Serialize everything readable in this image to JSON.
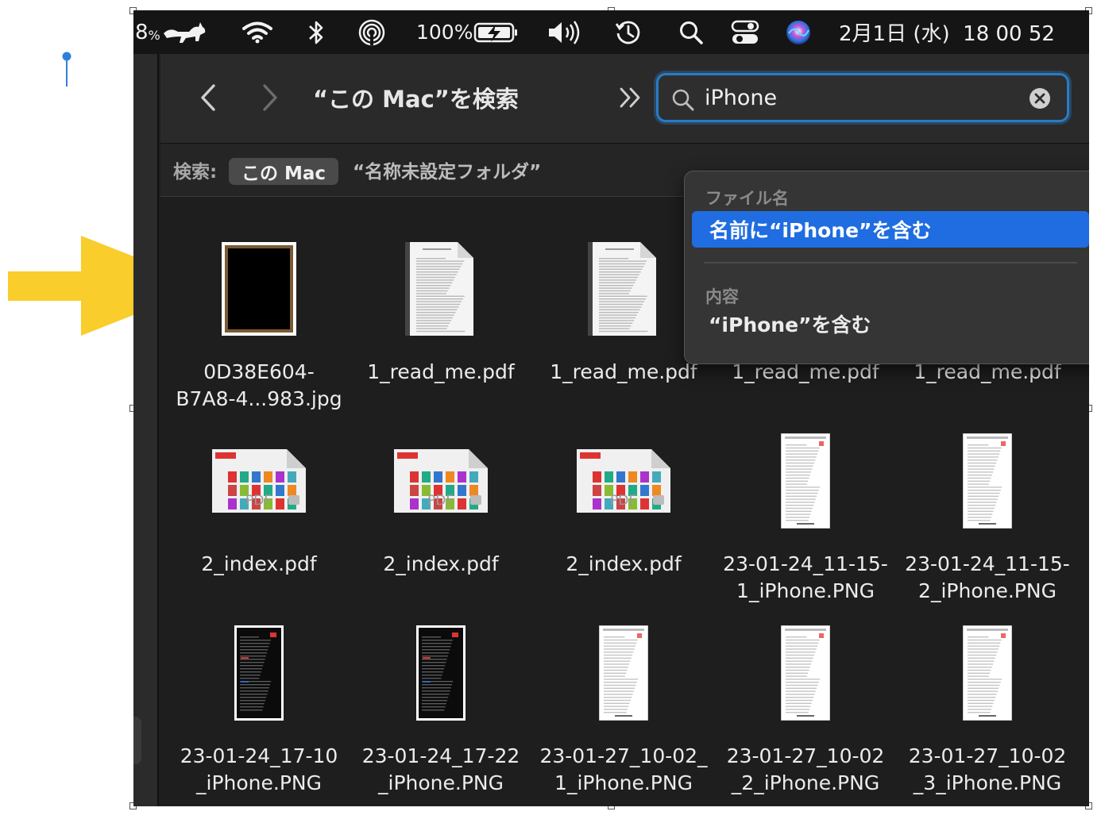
{
  "menubar": {
    "battery_partial": "8",
    "battery_percent_sign": "%",
    "battery_label": "100%",
    "datetime": "2月1日 (水)  18 00 52"
  },
  "toolbar": {
    "title": "“この Mac”を検索",
    "search_value": "iPhone"
  },
  "scopebar": {
    "label": "検索:",
    "active": "この Mac",
    "other": "“名称未設定フォルダ”"
  },
  "dropdown": {
    "section_filename": "ファイル名",
    "selected_item": "名前に“iPhone”を含む",
    "section_contents": "内容",
    "contents_item": "“iPhone”を含む"
  },
  "files": [
    {
      "name": "0D38E604-\nB7A8-4...983.jpg",
      "kind": "photo"
    },
    {
      "name": "1_read_me.pdf",
      "kind": "doc"
    },
    {
      "name": "1_read_me.pdf",
      "kind": "doc"
    },
    {
      "name": "1_read_me.pdf",
      "kind": "doc"
    },
    {
      "name": "1_read_me.pdf",
      "kind": "doc"
    },
    {
      "name": "2_index.pdf",
      "kind": "pdf-index"
    },
    {
      "name": "2_index.pdf",
      "kind": "pdf-index"
    },
    {
      "name": "2_index.pdf",
      "kind": "pdf-index"
    },
    {
      "name": "23-01-24_11-15-\n1_iPhone.PNG",
      "kind": "phone-light"
    },
    {
      "name": "23-01-24_11-15-\n2_iPhone.PNG",
      "kind": "phone-light"
    },
    {
      "name": "23-01-24_17-10\n_iPhone.PNG",
      "kind": "phone-dark"
    },
    {
      "name": "23-01-24_17-22\n_iPhone.PNG",
      "kind": "phone-dark"
    },
    {
      "name": "23-01-27_10-02_\n1_iPhone.PNG",
      "kind": "phone-light"
    },
    {
      "name": "23-01-27_10-02\n_2_iPhone.PNG",
      "kind": "phone-light"
    },
    {
      "name": "23-01-27_10-02\n_3_iPhone.PNG",
      "kind": "phone-light"
    }
  ],
  "colors": {
    "accent": "#1f6de0",
    "search_ring": "#2a7bc4",
    "arrow": "#f9cd2c",
    "pin": "#2d7fdc"
  }
}
